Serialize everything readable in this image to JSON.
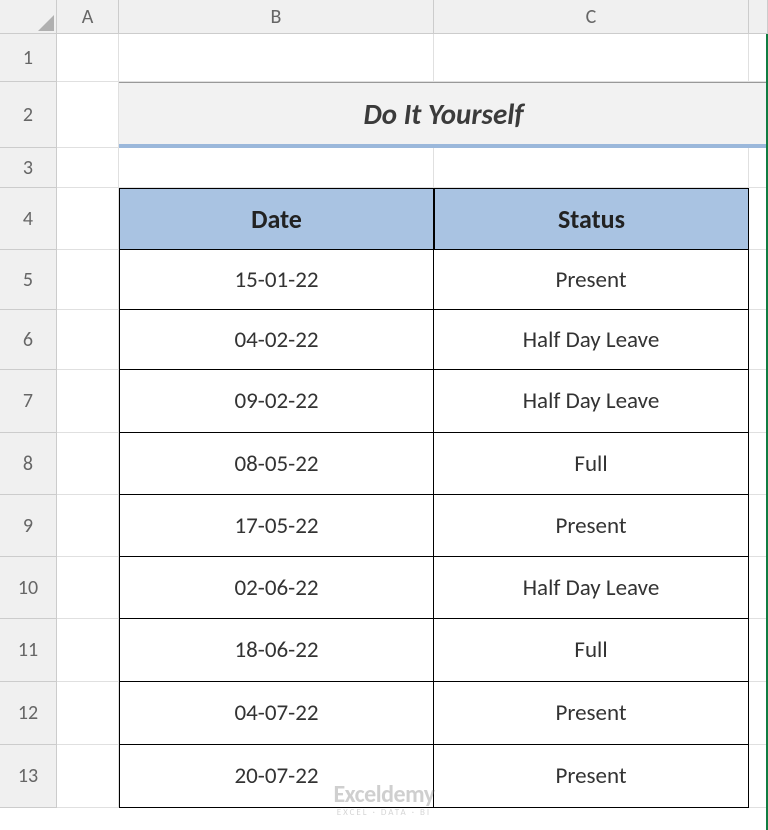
{
  "columns": [
    "A",
    "B",
    "C"
  ],
  "rows": [
    "1",
    "2",
    "3",
    "4",
    "5",
    "6",
    "7",
    "8",
    "9",
    "10",
    "11",
    "12",
    "13"
  ],
  "title": "Do It Yourself",
  "table": {
    "headers": {
      "date": "Date",
      "status": "Status"
    },
    "rows": [
      {
        "date": "15-01-22",
        "status": "Present"
      },
      {
        "date": "04-02-22",
        "status": "Half Day Leave"
      },
      {
        "date": "09-02-22",
        "status": "Half Day Leave"
      },
      {
        "date": "08-05-22",
        "status": "Full"
      },
      {
        "date": "17-05-22",
        "status": "Present"
      },
      {
        "date": "02-06-22",
        "status": "Half Day Leave"
      },
      {
        "date": "18-06-22",
        "status": "Full"
      },
      {
        "date": "04-07-22",
        "status": "Present"
      },
      {
        "date": "20-07-22",
        "status": "Present"
      }
    ]
  },
  "watermark": {
    "brand": "Exceldemy",
    "tag": "EXCEL · DATA · BI"
  }
}
